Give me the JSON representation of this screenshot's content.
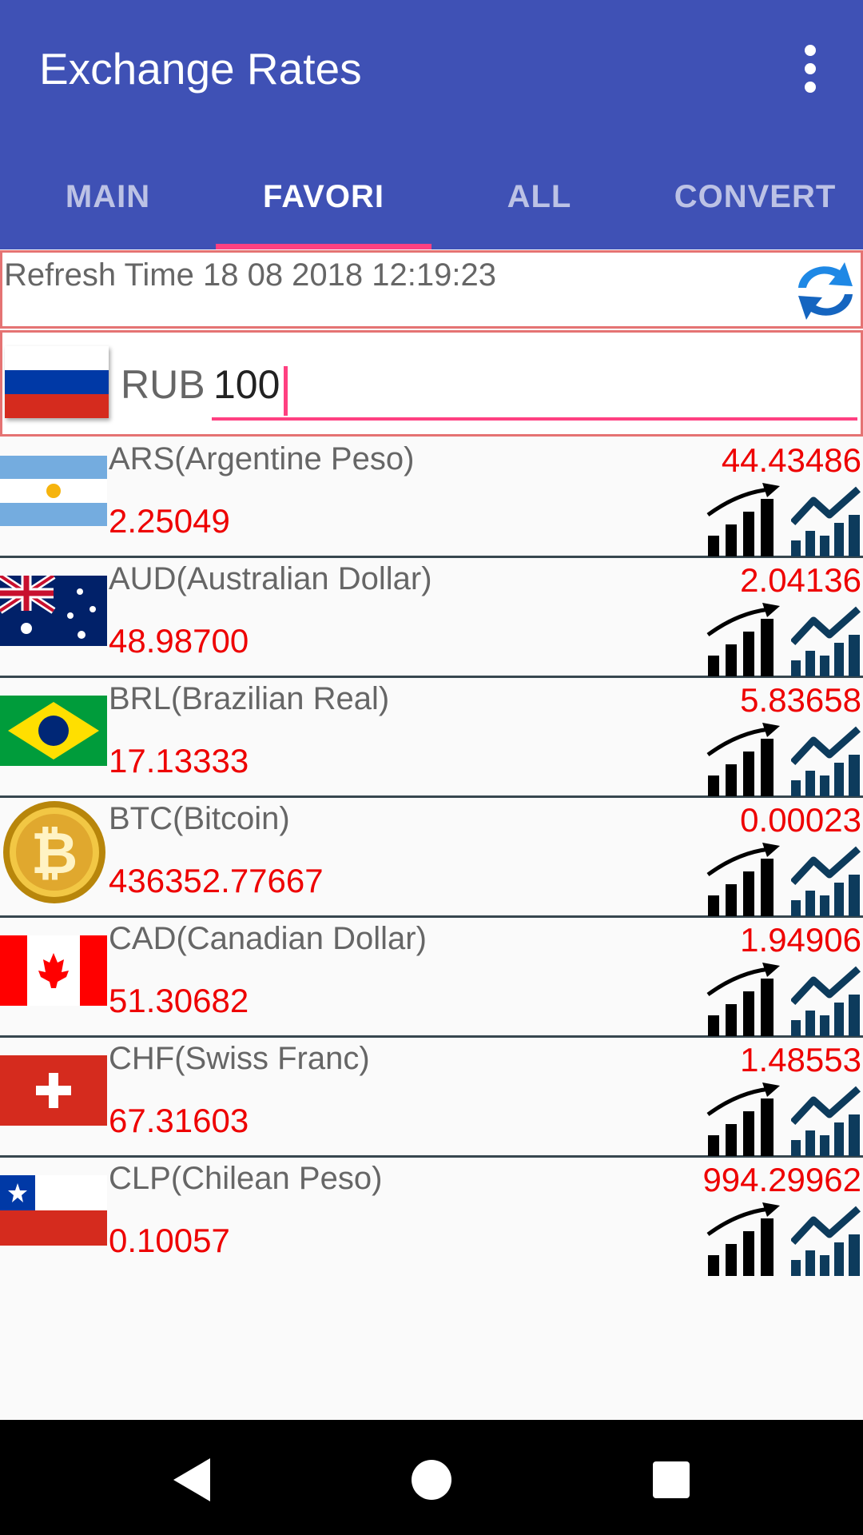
{
  "app": {
    "title": "Exchange Rates"
  },
  "colors": {
    "primary": "#3f51b5",
    "accent": "#ff4081",
    "value": "#ee0000",
    "border": "#e57373"
  },
  "icons": {
    "overflow": "more-vert-icon",
    "refresh": "refresh-icon",
    "bars": "bar-chart-icon",
    "trend": "trend-chart-icon",
    "nav_back": "back-icon",
    "nav_home": "home-icon",
    "nav_recent": "recents-icon"
  },
  "tabs": [
    {
      "label": "MAIN",
      "active": false
    },
    {
      "label": "FAVORI",
      "active": true
    },
    {
      "label": "ALL",
      "active": false
    },
    {
      "label": "CONVERT",
      "active": false
    }
  ],
  "refresh": {
    "text": "Refresh Time 18 08 2018 12:19:23"
  },
  "base": {
    "code": "RUB",
    "amount": "100",
    "flag": "russia"
  },
  "currencies": [
    {
      "name": "ARS(Argentine Peso)",
      "rate": "44.43486",
      "inverse": "2.25049",
      "flag": "argentina"
    },
    {
      "name": "AUD(Australian Dollar)",
      "rate": "2.04136",
      "inverse": "48.98700",
      "flag": "australia"
    },
    {
      "name": "BRL(Brazilian Real)",
      "rate": "5.83658",
      "inverse": "17.13333",
      "flag": "brazil"
    },
    {
      "name": "BTC(Bitcoin)",
      "rate": "0.00023",
      "inverse": "436352.77667",
      "flag": "bitcoin"
    },
    {
      "name": "CAD(Canadian Dollar)",
      "rate": "1.94906",
      "inverse": "51.30682",
      "flag": "canada"
    },
    {
      "name": "CHF(Swiss Franc)",
      "rate": "1.48553",
      "inverse": "67.31603",
      "flag": "switzerland"
    },
    {
      "name": "CLP(Chilean Peso)",
      "rate": "994.29962",
      "inverse": "0.10057",
      "flag": "chile"
    }
  ]
}
